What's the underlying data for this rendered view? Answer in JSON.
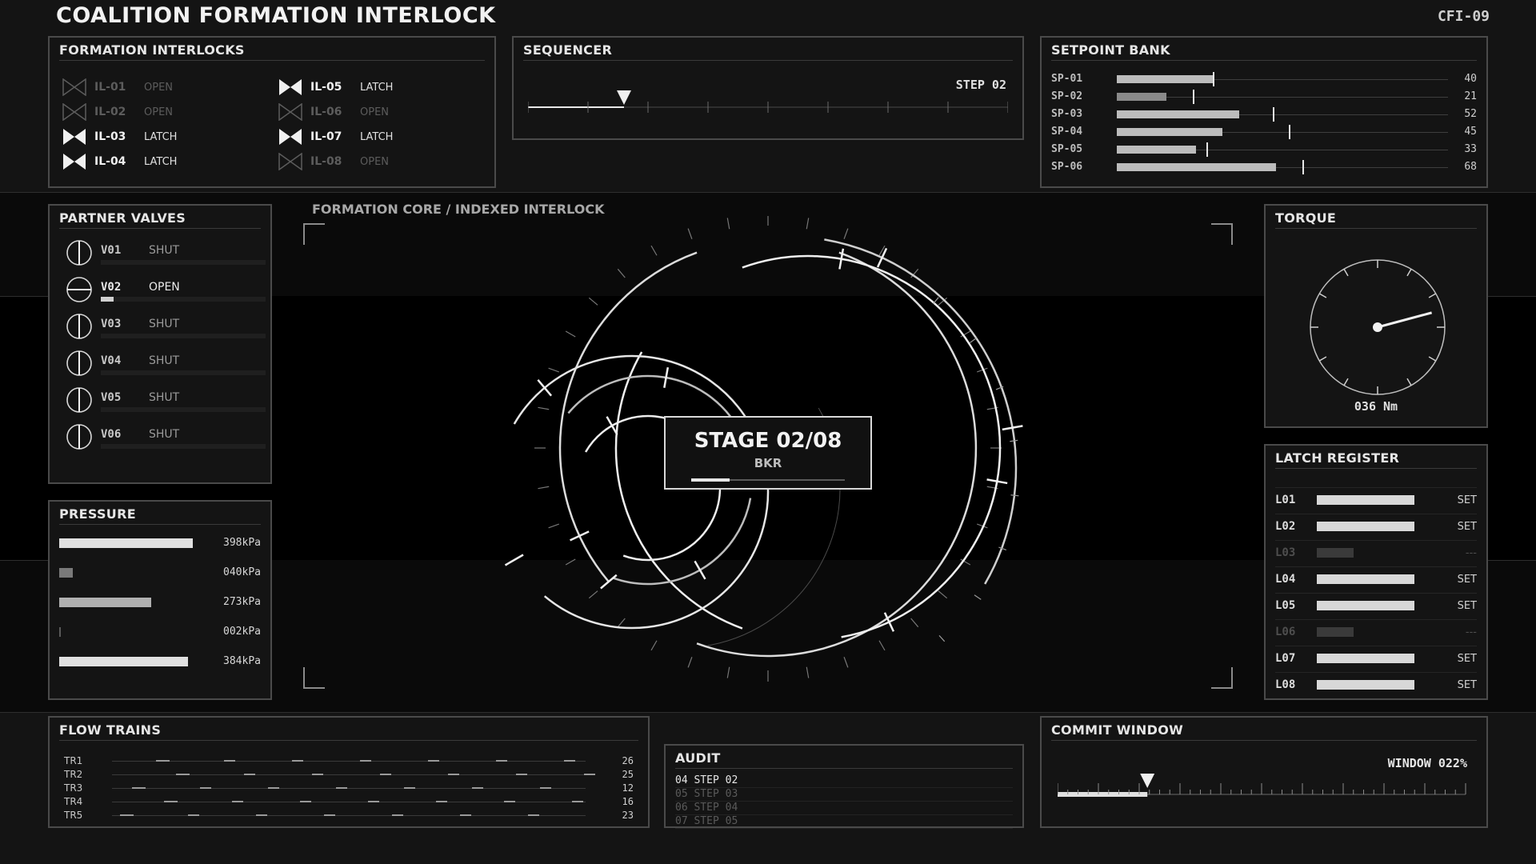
{
  "app": {
    "title": "COALITION FORMATION INTERLOCK",
    "code": "CFI-09"
  },
  "interlocks": {
    "title": "FORMATION INTERLOCKS",
    "items": [
      {
        "id": "IL-01",
        "state": "OPEN"
      },
      {
        "id": "IL-02",
        "state": "OPEN"
      },
      {
        "id": "IL-03",
        "state": "LATCH"
      },
      {
        "id": "IL-04",
        "state": "LATCH"
      },
      {
        "id": "IL-05",
        "state": "LATCH"
      },
      {
        "id": "IL-06",
        "state": "OPEN"
      },
      {
        "id": "IL-07",
        "state": "LATCH"
      },
      {
        "id": "IL-08",
        "state": "OPEN"
      }
    ]
  },
  "sequencer": {
    "title": "SEQUENCER",
    "step": "STEP 02",
    "step_index": 2,
    "step_count": 8
  },
  "setpoints": {
    "title": "SETPOINT BANK",
    "max": 100,
    "items": [
      {
        "id": "SP-01",
        "value": "40",
        "fill": 0.29,
        "marker": 0.29
      },
      {
        "id": "SP-02",
        "value": "21",
        "fill": 0.15,
        "marker": 0.23
      },
      {
        "id": "SP-03",
        "value": "52",
        "fill": 0.37,
        "marker": 0.47
      },
      {
        "id": "SP-04",
        "value": "45",
        "fill": 0.32,
        "marker": 0.52
      },
      {
        "id": "SP-05",
        "value": "33",
        "fill": 0.24,
        "marker": 0.27
      },
      {
        "id": "SP-06",
        "value": "68",
        "fill": 0.48,
        "marker": 0.56
      }
    ]
  },
  "valves": {
    "title": "PARTNER VALVES",
    "items": [
      {
        "id": "V01",
        "state": "SHUT",
        "open": false,
        "level": 0
      },
      {
        "id": "V02",
        "state": "OPEN",
        "open": true,
        "level": 0.08
      },
      {
        "id": "V03",
        "state": "SHUT",
        "open": false,
        "level": 0
      },
      {
        "id": "V04",
        "state": "SHUT",
        "open": false,
        "level": 0
      },
      {
        "id": "V05",
        "state": "SHUT",
        "open": false,
        "level": 0
      },
      {
        "id": "V06",
        "state": "SHUT",
        "open": false,
        "level": 0
      }
    ]
  },
  "pressure": {
    "title": "PRESSURE",
    "items": [
      {
        "value": "398kPa",
        "level": 0.398,
        "color": "#e0e0e0"
      },
      {
        "value": "040kPa",
        "level": 0.04,
        "color": "#7a7a7a"
      },
      {
        "value": "273kPa",
        "level": 0.273,
        "color": "#b0b0b0"
      },
      {
        "value": "002kPa",
        "level": 0.002,
        "color": "#5a5a5a"
      },
      {
        "value": "384kPa",
        "level": 0.384,
        "color": "#e0e0e0"
      }
    ]
  },
  "core": {
    "label": "FORMATION CORE / INDEXED INTERLOCK",
    "stage": "STAGE 02/08",
    "sub": "BKR",
    "progress": 0.25
  },
  "torque": {
    "title": "TORQUE",
    "value": "036 Nm"
  },
  "latch": {
    "title": "LATCH REGISTER",
    "items": [
      {
        "id": "L01",
        "state": "SET",
        "on": true
      },
      {
        "id": "L02",
        "state": "SET",
        "on": true
      },
      {
        "id": "L03",
        "state": "---",
        "on": false
      },
      {
        "id": "L04",
        "state": "SET",
        "on": true
      },
      {
        "id": "L05",
        "state": "SET",
        "on": true
      },
      {
        "id": "L06",
        "state": "---",
        "on": false
      },
      {
        "id": "L07",
        "state": "SET",
        "on": true
      },
      {
        "id": "L08",
        "state": "SET",
        "on": true
      }
    ]
  },
  "flow": {
    "title": "FLOW TRAINS",
    "items": [
      {
        "id": "TR1",
        "value": "26"
      },
      {
        "id": "TR2",
        "value": "25"
      },
      {
        "id": "TR3",
        "value": "12"
      },
      {
        "id": "TR4",
        "value": "16"
      },
      {
        "id": "TR5",
        "value": "23"
      }
    ]
  },
  "audit": {
    "title": "AUDIT",
    "items": [
      {
        "text": "04 STEP 02",
        "current": true
      },
      {
        "text": "05 STEP 03",
        "current": false
      },
      {
        "text": "06 STEP 04",
        "current": false
      },
      {
        "text": "07 STEP 05",
        "current": false
      }
    ]
  },
  "commit": {
    "title": "COMMIT WINDOW",
    "value": "WINDOW 022%",
    "level": 0.22
  },
  "colors": {
    "background": "#141414",
    "panel_border": "#4a4a4a",
    "text": "#e8e8e8",
    "dim": "#5c5c5c"
  }
}
